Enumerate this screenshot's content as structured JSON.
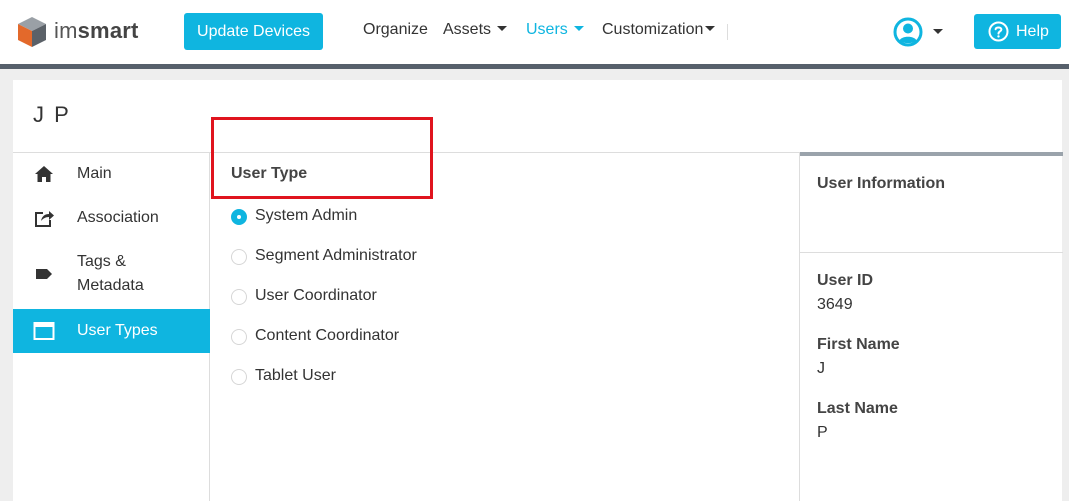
{
  "brand": {
    "name_prefix": "im",
    "name_suffix": "smart"
  },
  "header": {
    "update_button": "Update Devices",
    "nav": [
      {
        "label": "Organize",
        "has_menu": false,
        "active": false
      },
      {
        "label": "Assets",
        "has_menu": true,
        "active": false
      },
      {
        "label": "Users",
        "has_menu": true,
        "active": true
      },
      {
        "label": "Customization",
        "has_menu": true,
        "active": false
      }
    ],
    "user_icon": "user-circle-icon",
    "help_button": "Help",
    "help_icon": "question-circle-icon"
  },
  "page": {
    "title": "J P"
  },
  "sidebar": {
    "items": [
      {
        "label": "Main",
        "icon": "home-icon",
        "active": false
      },
      {
        "label": "Association",
        "icon": "share-icon",
        "active": false
      },
      {
        "label": "Tags &",
        "label_line2": "Metadata",
        "icon": "tag-icon",
        "active": false
      },
      {
        "label": "User Types",
        "icon": "window-icon",
        "active": true
      }
    ]
  },
  "user_type": {
    "heading": "User Type",
    "options": [
      {
        "label": "System Admin",
        "selected": true
      },
      {
        "label": "Segment Administrator",
        "selected": false
      },
      {
        "label": "User Coordinator",
        "selected": false
      },
      {
        "label": "Content Coordinator",
        "selected": false
      },
      {
        "label": "Tablet User",
        "selected": false
      }
    ]
  },
  "user_info": {
    "heading": "User Information",
    "fields": [
      {
        "label": "User ID",
        "value": "3649"
      },
      {
        "label": "First Name",
        "value": "J"
      },
      {
        "label": "Last Name",
        "value": "P"
      }
    ]
  },
  "colors": {
    "accent": "#0fb5e0",
    "highlight": "#e0141e",
    "nav_rule": "#56606b"
  }
}
